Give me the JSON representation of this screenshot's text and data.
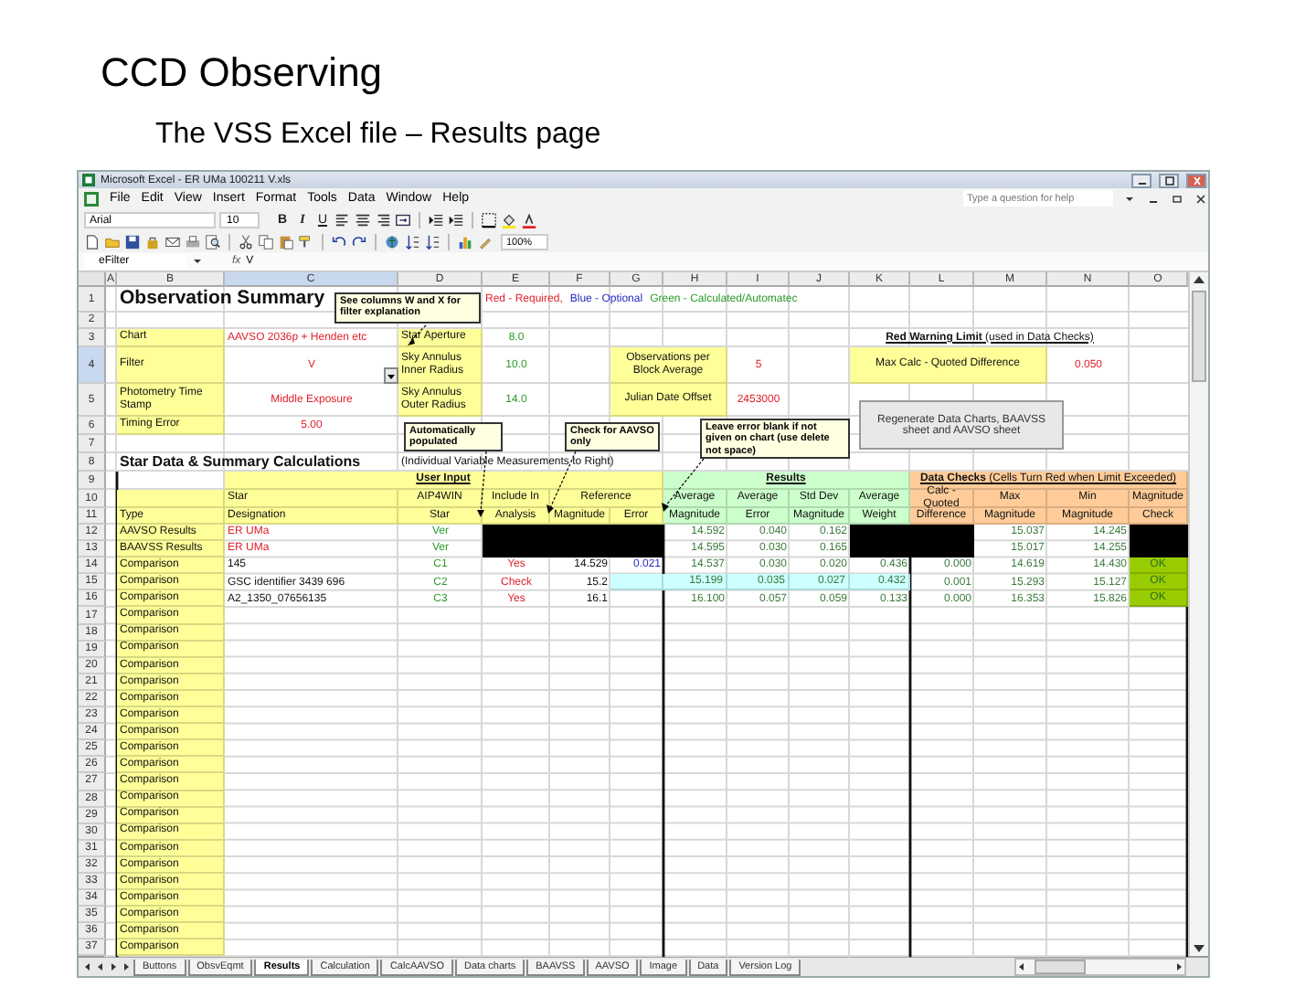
{
  "slide": {
    "title": "CCD Observing",
    "subtitle": "The VSS Excel file – Results page"
  },
  "window": {
    "title": "Microsoft Excel - ER UMa 100211 V.xls"
  },
  "menu": [
    "File",
    "Edit",
    "View",
    "Insert",
    "Format",
    "Tools",
    "Data",
    "Window",
    "Help"
  ],
  "help_box": {
    "placeholder": "Type a question for help"
  },
  "format_toolbar": {
    "font": "Arial",
    "size": "10",
    "style_buttons": [
      "B",
      "I",
      "U"
    ]
  },
  "standard_toolbar": {
    "zoom": "100%"
  },
  "formula_bar": {
    "name_box": "eFilter",
    "function_label": "fx",
    "value": "V"
  },
  "columns": [
    {
      "label": "A",
      "selected": false
    },
    {
      "label": "B",
      "selected": false
    },
    {
      "label": "C",
      "selected": true
    },
    {
      "label": "D",
      "selected": false
    },
    {
      "label": "E",
      "selected": false
    },
    {
      "label": "F",
      "selected": false
    },
    {
      "label": "G",
      "selected": false
    },
    {
      "label": "H",
      "selected": false
    },
    {
      "label": "I",
      "selected": false
    },
    {
      "label": "J",
      "selected": false
    },
    {
      "label": "K",
      "selected": false
    },
    {
      "label": "L",
      "selected": false
    },
    {
      "label": "M",
      "selected": false
    },
    {
      "label": "N",
      "selected": false
    },
    {
      "label": "O",
      "selected": false
    }
  ],
  "rows": [
    {
      "label": "1",
      "selected": false,
      "cells": {
        "B:C": {
          "text": "Observation Summary",
          "kind": "title"
        },
        "E:J": {
          "kind": "legend",
          "parts": [
            {
              "text": "Red - Required,",
              "color": "#e0202a"
            },
            {
              "text": "Blue - Optional",
              "color": "#2828c0"
            },
            {
              "text": "Green - Calculated/Automatec",
              "color": "#2a9a2a"
            }
          ]
        }
      }
    },
    {
      "label": "2",
      "selected": false,
      "cells": {}
    },
    {
      "label": "3",
      "selected": false,
      "cells": {
        "B": {
          "text": "Chart",
          "kind": "label"
        },
        "C": {
          "text": "AAVSO 2036p + Henden etc",
          "kind": "input"
        },
        "D": {
          "text": "Star Aperture",
          "kind": "label"
        },
        "E": {
          "text": "8.0",
          "kind": "auto"
        },
        "K:N": {
          "text": "**Red Warning Limit** (used in Data Checks)",
          "kind": "caption"
        }
      }
    },
    {
      "label": "4",
      "selected": true,
      "cells": {
        "B": {
          "text": "Filter",
          "kind": "label"
        },
        "C": {
          "text": "V",
          "kind": "entry"
        },
        "D": {
          "text": "Sky Annulus Inner Radius",
          "kind": "label"
        },
        "E": {
          "text": "10.0",
          "kind": "auto"
        },
        "G:H": {
          "text": "Observations per Block Average",
          "kind": "field"
        },
        "I": {
          "text": "5",
          "kind": "entry"
        },
        "K:M": {
          "text": "Max Calc - Quoted Difference",
          "kind": "field"
        },
        "N": {
          "text": "0.050",
          "kind": "entry"
        }
      }
    },
    {
      "label": "5",
      "selected": false,
      "cells": {
        "B": {
          "text": "Photometry Time Stamp",
          "kind": "label"
        },
        "C": {
          "text": "Middle Exposure",
          "kind": "entry"
        },
        "D": {
          "text": "Sky Annulus Outer Radius",
          "kind": "label"
        },
        "E": {
          "text": "14.0",
          "kind": "auto"
        },
        "G:H": {
          "text": "Julian Date Offset",
          "kind": "field"
        },
        "I": {
          "text": "2453000",
          "kind": "entry"
        }
      }
    },
    {
      "label": "6",
      "selected": false,
      "cells": {
        "B": {
          "text": "Timing Error",
          "kind": "label"
        },
        "C": {
          "text": "5.00",
          "kind": "entry"
        }
      }
    },
    {
      "label": "7",
      "selected": false,
      "cells": {}
    },
    {
      "label": "8",
      "selected": false,
      "cells": {
        "B:C": {
          "text": "Star Data & Summary Calculations",
          "kind": "heading"
        },
        "D:G": {
          "text": "(Individual Variable Measurements to Right)",
          "kind": "plain"
        }
      }
    },
    {
      "label": "9",
      "selected": false,
      "cells": {
        "C:G": {
          "text": "User Input",
          "kind": "group"
        },
        "H:K": {
          "text": "Results",
          "kind": "results"
        },
        "L:O": {
          "text": "**Data Checks** (Cells Turn Red when Limit Exceeded)",
          "kind": "checks"
        }
      }
    },
    {
      "label": "10",
      "selected": false,
      "cells": {
        "B": {
          "kind": "label"
        },
        "C": {
          "text": "Star",
          "kind": "label"
        },
        "D": {
          "text": "AIP4WIN",
          "kind": "field"
        },
        "E": {
          "text": "Include In",
          "kind": "field"
        },
        "F:G": {
          "text": "Reference",
          "kind": "field"
        },
        "H": {
          "text": "Average",
          "kind": "calc"
        },
        "I": {
          "text": "Average",
          "kind": "calc"
        },
        "J": {
          "text": "Std Dev",
          "kind": "calc"
        },
        "K": {
          "text": "Average",
          "kind": "calc"
        },
        "L": {
          "text": "Calc - Quoted",
          "kind": "check"
        },
        "M": {
          "text": "Max",
          "kind": "check"
        },
        "N": {
          "text": "Min",
          "kind": "check"
        },
        "O": {
          "text": "Magnitude",
          "kind": "check"
        }
      }
    },
    {
      "label": "11",
      "selected": false,
      "cells": {
        "B": {
          "text": "Type",
          "kind": "label"
        },
        "C": {
          "text": "Designation",
          "kind": "label"
        },
        "D": {
          "text": "Star",
          "kind": "field"
        },
        "E": {
          "text": "Analysis",
          "kind": "field"
        },
        "F": {
          "text": "Magnitude",
          "kind": "field"
        },
        "G": {
          "text": "Error",
          "kind": "field"
        },
        "H": {
          "text": "Magnitude",
          "kind": "calc"
        },
        "I": {
          "text": "Error",
          "kind": "calc"
        },
        "J": {
          "text": "Magnitude",
          "kind": "calc"
        },
        "K": {
          "text": "Weight",
          "kind": "calc"
        },
        "L": {
          "text": "Difference",
          "kind": "check"
        },
        "M": {
          "text": "Magnitude",
          "kind": "check"
        },
        "N": {
          "text": "Magnitude",
          "kind": "check"
        },
        "O": {
          "text": "Check",
          "kind": "check"
        }
      }
    },
    {
      "label": "12",
      "selected": false,
      "cells": {
        "B": {
          "text": "AAVSO Results",
          "kind": "label"
        },
        "C": {
          "text": "ER UMa",
          "kind": "input"
        },
        "D": {
          "text": "Ver",
          "kind": "auto"
        },
        "E:G": {
          "kind": "mask"
        },
        "H": {
          "text": "14.592",
          "kind": "result"
        },
        "I": {
          "text": "0.040",
          "kind": "result"
        },
        "J": {
          "text": "0.162",
          "kind": "result"
        },
        "K:L": {
          "kind": "mask"
        },
        "M": {
          "text": "15.037",
          "kind": "result"
        },
        "N": {
          "text": "14.245",
          "kind": "result"
        },
        "O": {
          "kind": "mask"
        }
      }
    },
    {
      "label": "13",
      "selected": false,
      "cells": {
        "B": {
          "text": "BAAVSS Results",
          "kind": "label"
        },
        "C": {
          "text": "ER UMa",
          "kind": "input"
        },
        "D": {
          "text": "Ver",
          "kind": "auto"
        },
        "E:G": {
          "kind": "mask"
        },
        "H": {
          "text": "14.595",
          "kind": "result"
        },
        "I": {
          "text": "0.030",
          "kind": "result"
        },
        "J": {
          "text": "0.165",
          "kind": "result"
        },
        "K:L": {
          "kind": "mask"
        },
        "M": {
          "text": "15.017",
          "kind": "result"
        },
        "N": {
          "text": "14.255",
          "kind": "result"
        },
        "O": {
          "kind": "mask"
        }
      }
    },
    {
      "label": "14",
      "selected": false,
      "cells": {
        "B": {
          "text": "Comparison",
          "kind": "label"
        },
        "C": {
          "text": "145",
          "kind": "plain"
        },
        "D": {
          "text": "C1",
          "kind": "auto"
        },
        "E": {
          "text": "Yes",
          "kind": "entry"
        },
        "F": {
          "text": "14.529",
          "kind": "number"
        },
        "G": {
          "text": "0.021",
          "kind": "optional"
        },
        "H": {
          "text": "14.537",
          "kind": "result"
        },
        "I": {
          "text": "0.030",
          "kind": "result"
        },
        "J": {
          "text": "0.020",
          "kind": "result"
        },
        "K": {
          "text": "0.436",
          "kind": "result"
        },
        "L": {
          "text": "0.000",
          "kind": "result"
        },
        "M": {
          "text": "14.619",
          "kind": "result"
        },
        "N": {
          "text": "14.430",
          "kind": "result"
        },
        "O": {
          "text": "OK",
          "kind": "ok"
        }
      }
    },
    {
      "label": "15",
      "selected": false,
      "cells": {
        "B": {
          "text": "Comparison",
          "kind": "label"
        },
        "C": {
          "text": "GSC identifier 3439 696",
          "kind": "plain"
        },
        "D": {
          "text": "C2",
          "kind": "auto"
        },
        "E": {
          "text": "Check",
          "kind": "entry"
        },
        "F": {
          "text": "15.2",
          "kind": "number"
        },
        "G": {
          "kind": "shade"
        },
        "H": {
          "text": "15.199",
          "kind": "highlighted"
        },
        "I": {
          "text": "0.035",
          "kind": "highlighted"
        },
        "J": {
          "text": "0.027",
          "kind": "highlighted"
        },
        "K": {
          "text": "0.432",
          "kind": "highlighted"
        },
        "L": {
          "text": "0.001",
          "kind": "result"
        },
        "M": {
          "text": "15.293",
          "kind": "result"
        },
        "N": {
          "text": "15.127",
          "kind": "result"
        },
        "O": {
          "text": "OK",
          "kind": "ok"
        }
      }
    },
    {
      "label": "16",
      "selected": false,
      "cells": {
        "B": {
          "text": "Comparison",
          "kind": "label"
        },
        "C": {
          "text": "A2_1350_07656135",
          "kind": "plain"
        },
        "D": {
          "text": "C3",
          "kind": "auto"
        },
        "E": {
          "text": "Yes",
          "kind": "entry"
        },
        "F": {
          "text": "16.1",
          "kind": "number"
        },
        "H": {
          "text": "16.100",
          "kind": "result"
        },
        "I": {
          "text": "0.057",
          "kind": "result"
        },
        "J": {
          "text": "0.059",
          "kind": "result"
        },
        "K": {
          "text": "0.133",
          "kind": "result"
        },
        "L": {
          "text": "0.000",
          "kind": "result"
        },
        "M": {
          "text": "16.353",
          "kind": "result"
        },
        "N": {
          "text": "15.826",
          "kind": "result"
        },
        "O": {
          "text": "OK",
          "kind": "ok"
        }
      }
    },
    {
      "label": "17",
      "selected": false,
      "cells": {
        "B": {
          "text": "Comparison",
          "kind": "label"
        }
      }
    },
    {
      "label": "18",
      "selected": false,
      "cells": {
        "B": {
          "text": "Comparison",
          "kind": "label"
        }
      }
    },
    {
      "label": "19",
      "selected": false,
      "cells": {
        "B": {
          "text": "Comparison",
          "kind": "label"
        }
      }
    },
    {
      "label": "20",
      "selected": false,
      "cells": {
        "B": {
          "text": "Comparison",
          "kind": "label"
        }
      }
    },
    {
      "label": "21",
      "selected": false,
      "cells": {
        "B": {
          "text": "Comparison",
          "kind": "label"
        }
      }
    },
    {
      "label": "22",
      "selected": false,
      "cells": {
        "B": {
          "text": "Comparison",
          "kind": "label"
        }
      }
    },
    {
      "label": "23",
      "selected": false,
      "cells": {
        "B": {
          "text": "Comparison",
          "kind": "label"
        }
      }
    },
    {
      "label": "24",
      "selected": false,
      "cells": {
        "B": {
          "text": "Comparison",
          "kind": "label"
        }
      }
    },
    {
      "label": "25",
      "selected": false,
      "cells": {
        "B": {
          "text": "Comparison",
          "kind": "label"
        }
      }
    },
    {
      "label": "26",
      "selected": false,
      "cells": {
        "B": {
          "text": "Comparison",
          "kind": "label"
        }
      }
    },
    {
      "label": "27",
      "selected": false,
      "cells": {
        "B": {
          "text": "Comparison",
          "kind": "label"
        }
      }
    },
    {
      "label": "28",
      "selected": false,
      "cells": {
        "B": {
          "text": "Comparison",
          "kind": "label"
        }
      }
    },
    {
      "label": "29",
      "selected": false,
      "cells": {
        "B": {
          "text": "Comparison",
          "kind": "label"
        }
      }
    },
    {
      "label": "30",
      "selected": false,
      "cells": {
        "B": {
          "text": "Comparison",
          "kind": "label"
        }
      }
    },
    {
      "label": "31",
      "selected": false,
      "cells": {
        "B": {
          "text": "Comparison",
          "kind": "label"
        }
      }
    },
    {
      "label": "32",
      "selected": false,
      "cells": {
        "B": {
          "text": "Comparison",
          "kind": "label"
        }
      }
    },
    {
      "label": "33",
      "selected": false,
      "cells": {
        "B": {
          "text": "Comparison",
          "kind": "label"
        }
      }
    },
    {
      "label": "34",
      "selected": false,
      "cells": {
        "B": {
          "text": "Comparison",
          "kind": "label"
        }
      }
    },
    {
      "label": "35",
      "selected": false,
      "cells": {
        "B": {
          "text": "Comparison",
          "kind": "label"
        }
      }
    },
    {
      "label": "36",
      "selected": false,
      "cells": {
        "B": {
          "text": "Comparison",
          "kind": "label"
        }
      }
    },
    {
      "label": "37",
      "selected": false,
      "cells": {
        "B": {
          "text": "Comparison",
          "kind": "label"
        }
      }
    }
  ],
  "notes": [
    "See columns W and X for filter explanation",
    "Automatically populated",
    "Check for AAVSO only",
    "Leave error blank if not given on chart (use delete not space)"
  ],
  "sheet_button": "Regenerate Data Charts, BAAVSS sheet and AAVSO sheet",
  "sheet_tabs": [
    {
      "label": "Buttons",
      "selected": false
    },
    {
      "label": "ObsvEqmt",
      "selected": false
    },
    {
      "label": "Results",
      "selected": true
    },
    {
      "label": "Calculation",
      "selected": false
    },
    {
      "label": "CalcAAVSO",
      "selected": false
    },
    {
      "label": "Data charts",
      "selected": false
    },
    {
      "label": "BAAVSS",
      "selected": false
    },
    {
      "label": "AAVSO",
      "selected": false
    },
    {
      "label": "Image",
      "selected": false
    },
    {
      "label": "Data",
      "selected": false
    },
    {
      "label": "Version Log",
      "selected": false
    }
  ]
}
